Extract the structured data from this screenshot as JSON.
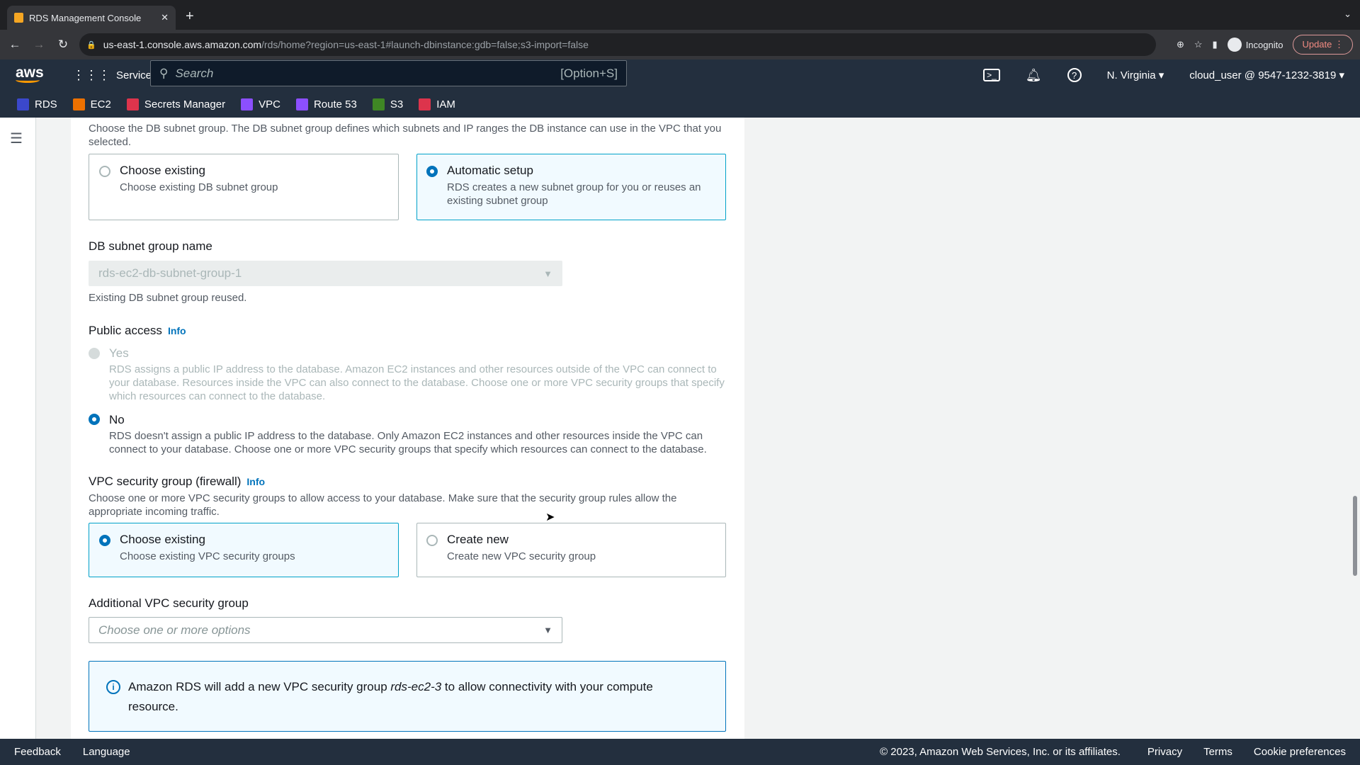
{
  "browser": {
    "tab_title": "RDS Management Console",
    "url_host": "us-east-1.console.aws.amazon.com",
    "url_path": "/rds/home?region=us-east-1#launch-dbinstance:gdb=false;s3-import=false",
    "incognito": "Incognito",
    "update": "Update"
  },
  "aws_nav": {
    "logo": "aws",
    "services": "Services",
    "search_placeholder": "Search",
    "search_shortcut": "[Option+S]",
    "region": "N. Virginia",
    "account": "cloud_user @ 9547-1232-3819"
  },
  "favorites": [
    {
      "label": "RDS",
      "color": "#3b48cc"
    },
    {
      "label": "EC2",
      "color": "#ed7100"
    },
    {
      "label": "Secrets Manager",
      "color": "#dd344c"
    },
    {
      "label": "VPC",
      "color": "#8c4fff"
    },
    {
      "label": "Route 53",
      "color": "#8c4fff"
    },
    {
      "label": "S3",
      "color": "#3f8624"
    },
    {
      "label": "IAM",
      "color": "#dd344c"
    }
  ],
  "subnet": {
    "description": "Choose the DB subnet group. The DB subnet group defines which subnets and IP ranges the DB instance can use in the VPC that you selected.",
    "options": [
      {
        "title": "Choose existing",
        "desc": "Choose existing DB subnet group",
        "selected": false
      },
      {
        "title": "Automatic setup",
        "desc": "RDS creates a new subnet group for you or reuses an existing subnet group",
        "selected": true
      }
    ],
    "name_label": "DB subnet group name",
    "name_value": "rds-ec2-db-subnet-group-1",
    "name_hint": "Existing DB subnet group reused."
  },
  "public_access": {
    "label": "Public access",
    "info": "Info",
    "yes": {
      "title": "Yes",
      "desc": "RDS assigns a public IP address to the database. Amazon EC2 instances and other resources outside of the VPC can connect to your database. Resources inside the VPC can also connect to the database. Choose one or more VPC security groups that specify which resources can connect to the database.",
      "disabled": true
    },
    "no": {
      "title": "No",
      "desc": "RDS doesn't assign a public IP address to the database. Only Amazon EC2 instances and other resources inside the VPC can connect to your database. Choose one or more VPC security groups that specify which resources can connect to the database.",
      "selected": true
    }
  },
  "security_group": {
    "label": "VPC security group (firewall)",
    "info": "Info",
    "description": "Choose one or more VPC security groups to allow access to your database. Make sure that the security group rules allow the appropriate incoming traffic.",
    "options": [
      {
        "title": "Choose existing",
        "desc": "Choose existing VPC security groups",
        "selected": true
      },
      {
        "title": "Create new",
        "desc": "Create new VPC security group",
        "selected": false
      }
    ],
    "additional_label": "Additional VPC security group",
    "additional_placeholder": "Choose one or more options",
    "notice_pre": "Amazon RDS will add a new VPC security group ",
    "notice_name": "rds-ec2-3",
    "notice_post": " to allow connectivity with your compute resource."
  },
  "footer": {
    "feedback": "Feedback",
    "language": "Language",
    "copyright": "© 2023, Amazon Web Services, Inc. or its affiliates.",
    "privacy": "Privacy",
    "terms": "Terms",
    "cookies": "Cookie preferences"
  }
}
